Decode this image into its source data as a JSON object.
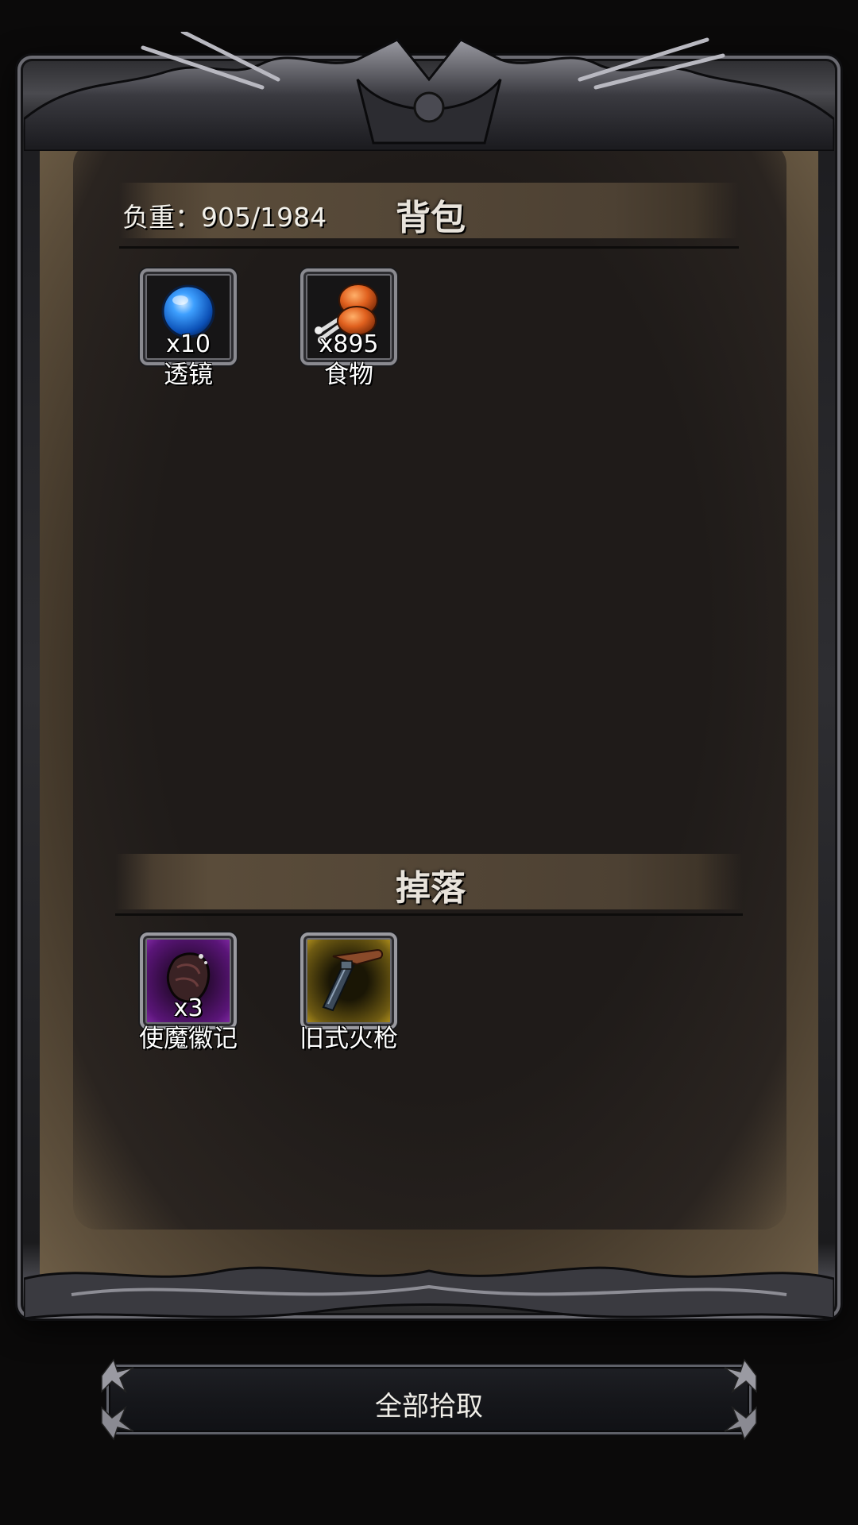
{
  "backpack": {
    "weight_label": "负重：905/1984",
    "title": "背包",
    "items": [
      {
        "name": "透镜",
        "count": "x10",
        "icon": "blue-orb-icon"
      },
      {
        "name": "食物",
        "count": "x895",
        "icon": "meat-drumstick-icon"
      }
    ]
  },
  "drops": {
    "title": "掉落",
    "items": [
      {
        "name": "使魔徽记",
        "count": "x3",
        "icon": "familiar-emblem-icon",
        "rarity_color": "#8e2fb3"
      },
      {
        "name": "旧式火枪",
        "count": "",
        "icon": "flintlock-pistol-icon",
        "rarity_color": "#c9a41f"
      }
    ]
  },
  "actions": {
    "pick_all_label": "全部拾取"
  }
}
